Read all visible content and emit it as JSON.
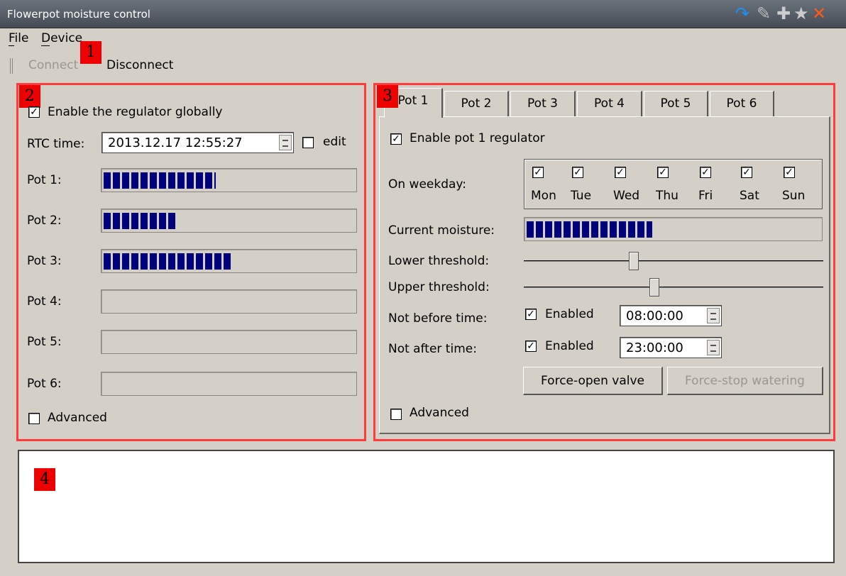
{
  "window": {
    "title": "Flowerpot moisture control"
  },
  "titlebar_icons": [
    "back-arrow-icon",
    "pin-icon",
    "plus-icon",
    "star-icon",
    "close-icon"
  ],
  "menu": {
    "file": "File",
    "device": "Device"
  },
  "toolbar": {
    "connect": "Connect",
    "disconnect": "Disconnect"
  },
  "annotations": [
    "1",
    "2",
    "3",
    "4"
  ],
  "left": {
    "enable_global": "Enable the regulator globally",
    "rtc_label": "RTC time:",
    "rtc_value": "2013.12.17 12:55:27",
    "edit": "edit",
    "pots": [
      {
        "label": "Pot 1:",
        "level": 0.45
      },
      {
        "label": "Pot 2:",
        "level": 0.29
      },
      {
        "label": "Pot 3:",
        "level": 0.51
      },
      {
        "label": "Pot 4:",
        "level": 0
      },
      {
        "label": "Pot 5:",
        "level": 0
      },
      {
        "label": "Pot 6:",
        "level": 0
      }
    ],
    "advanced": "Advanced"
  },
  "tabs": [
    "Pot 1",
    "Pot 2",
    "Pot 3",
    "Pot 4",
    "Pot 5",
    "Pot 6"
  ],
  "right": {
    "enable_pot": "Enable pot 1 regulator",
    "weekday_label": "On weekday:",
    "weekdays": [
      "Mon",
      "Tue",
      "Wed",
      "Thu",
      "Fri",
      "Sat",
      "Sun"
    ],
    "current_moisture": "Current moisture:",
    "current_moisture_level": 0.43,
    "lower_threshold": "Lower threshold:",
    "lower_value": 0.35,
    "upper_threshold": "Upper threshold:",
    "upper_value": 0.42,
    "not_before": "Not before time:",
    "not_before_enabled": "Enabled",
    "not_before_value": "08:00:00",
    "not_after": "Not after time:",
    "not_after_enabled": "Enabled",
    "not_after_value": "23:00:00",
    "force_open": "Force-open valve",
    "force_stop": "Force-stop watering",
    "advanced": "Advanced"
  }
}
